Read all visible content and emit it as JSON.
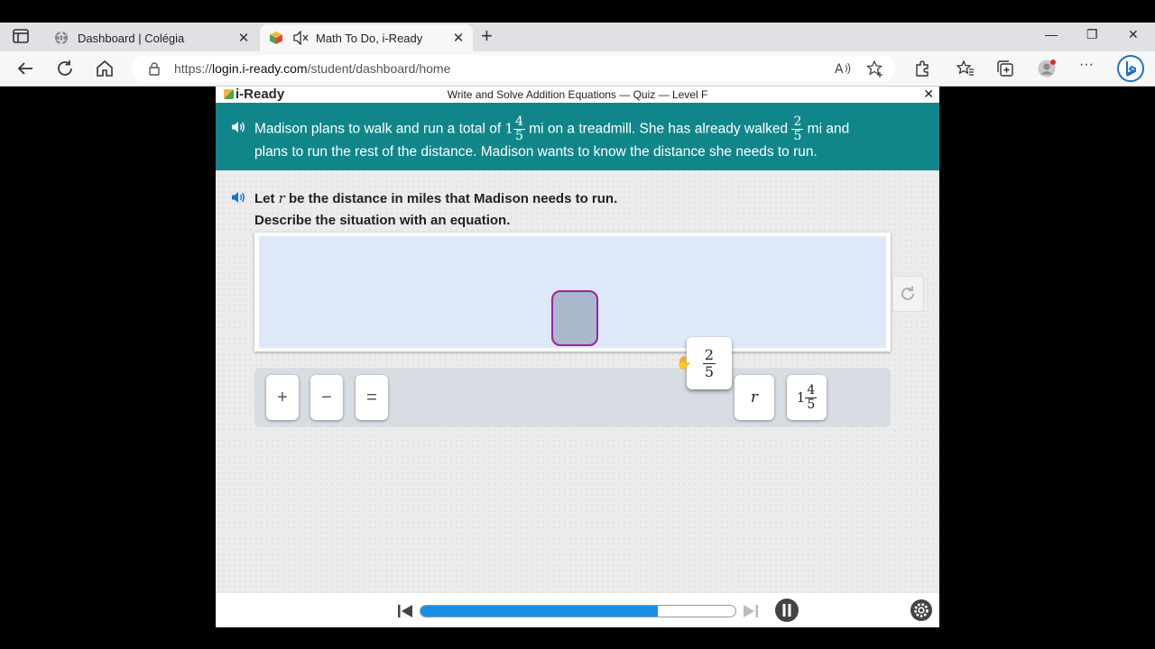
{
  "browser": {
    "tabs": [
      {
        "title": "Dashboard | Colégia",
        "active": false
      },
      {
        "title": "Math To Do, i-Ready",
        "active": true
      }
    ],
    "url_prefix": "https://",
    "url_host": "login.i-ready.com",
    "url_path": "/student/dashboard/home",
    "new_tab_label": "+",
    "window_controls": {
      "minimize": "—",
      "restore": "❐",
      "close": "✕"
    }
  },
  "app": {
    "logo": "i-Ready",
    "title": "Write and Solve Addition Equations — Quiz — Level F",
    "close": "✕",
    "problem": {
      "part1": "Madison plans to walk and run a total of ",
      "total_whole": "1",
      "total_num": "4",
      "total_den": "5",
      "part2": " mi on a treadmill. She has already walked ",
      "walked_num": "2",
      "walked_den": "5",
      "part3": " mi and",
      "line2": "plans to run the rest of the distance. Madison wants to know the distance she needs to run."
    },
    "prompt": {
      "let": "Let ",
      "var": "r",
      "rest": " be the distance in miles that Madison needs to run.",
      "line2": "Describe the situation with an equation."
    },
    "tiles": {
      "plus": "+",
      "minus": "−",
      "equals": "=",
      "var": "r",
      "mixed_whole": "1",
      "mixed_num": "4",
      "mixed_den": "5"
    },
    "dragging_tile": {
      "num": "2",
      "den": "5"
    },
    "progress": 0.755
  },
  "colors": {
    "banner": "#11868a",
    "progress": "#1a8ee6",
    "slot_border": "#a020a8"
  }
}
